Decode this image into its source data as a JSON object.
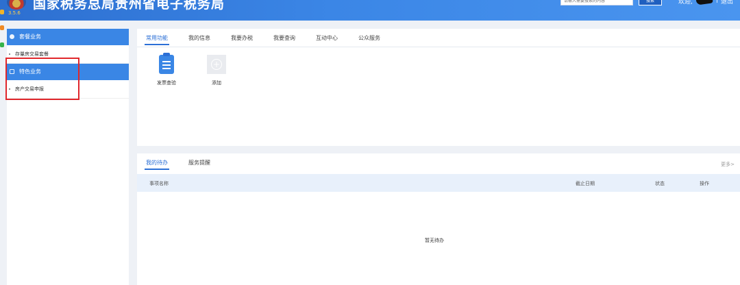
{
  "header": {
    "title": "国家税务总局贵州省电子税务局",
    "version": "3.5.6",
    "search_placeholder": "请输入需要搜索的内容",
    "search_button": "搜索",
    "welcome": "欢迎,",
    "separator": "|",
    "logout": "退出",
    "accent": "#3a86e5"
  },
  "sidebar": {
    "groups": [
      {
        "label": "套餐业务",
        "icon": "package-icon",
        "items": [
          "存量房交易套餐"
        ]
      },
      {
        "label": "特色业务",
        "icon": "grid-icon",
        "items": [
          "房产交易申报"
        ]
      }
    ],
    "highlight_color": "#e0262b"
  },
  "top_panel": {
    "tabs": [
      "常用功能",
      "我的信息",
      "我要办税",
      "我要查询",
      "互动中心",
      "公众服务"
    ],
    "active_tab": "常用功能",
    "functions": [
      {
        "label": "发票查验",
        "icon": "invoice-document-icon"
      },
      {
        "label": "添加",
        "icon": "add-icon"
      }
    ]
  },
  "bottom_panel": {
    "tabs": [
      "我的待办",
      "服务提醒"
    ],
    "active_tab": "我的待办",
    "more": "更多>",
    "columns": [
      "事项名称",
      "截止日期",
      "状态",
      "操作"
    ],
    "empty_text": "暂无待办"
  }
}
